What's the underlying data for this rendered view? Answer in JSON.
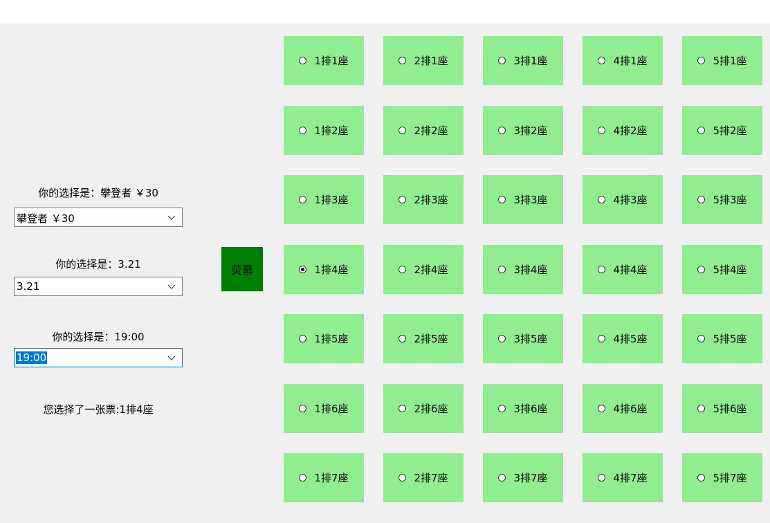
{
  "left_panel": {
    "role_label": "你的选择是：攀登者 ￥30",
    "role_value": "攀登者 ￥30",
    "date_label": "你的选择是：3.21",
    "date_value": "3.21",
    "time_label": "你的选择是：19:00",
    "time_value": "19:00",
    "ticket_status": "您选择了一张票:1排4座"
  },
  "screen_label": "荧幕",
  "seats": {
    "r1c1": "1排1座",
    "r1c2": "2排1座",
    "r1c3": "3排1座",
    "r1c4": "4排1座",
    "r1c5": "5排1座",
    "r2c1": "1排2座",
    "r2c2": "2排2座",
    "r2c3": "3排2座",
    "r2c4": "4排2座",
    "r2c5": "5排2座",
    "r3c1": "1排3座",
    "r3c2": "2排3座",
    "r3c3": "3排3座",
    "r3c4": "4排3座",
    "r3c5": "5排3座",
    "r4c1": "1排4座",
    "r4c2": "2排4座",
    "r4c3": "3排4座",
    "r4c4": "4排4座",
    "r4c5": "5排4座",
    "r5c1": "1排5座",
    "r5c2": "2排5座",
    "r5c3": "3排5座",
    "r5c4": "4排5座",
    "r5c5": "5排5座",
    "r6c1": "1排6座",
    "r6c2": "2排6座",
    "r6c3": "3排6座",
    "r6c4": "4排6座",
    "r6c5": "5排6座",
    "r7c1": "1排7座",
    "r7c2": "2排7座",
    "r7c3": "3排7座",
    "r7c4": "4排7座",
    "r7c5": "5排7座"
  },
  "selected_seat": "1排4座",
  "colors": {
    "seat_bg": "#90ee90",
    "screen_bg": "#008000",
    "window_bg": "#f0f0f0",
    "focus_accent": "#0078d7"
  }
}
